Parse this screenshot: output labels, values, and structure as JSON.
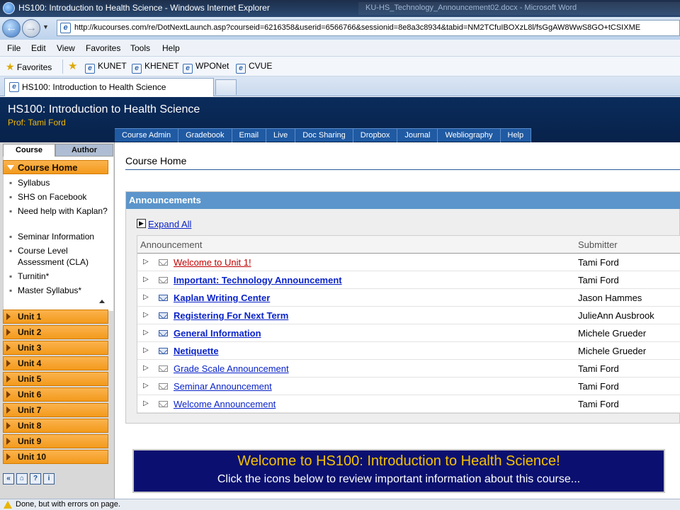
{
  "browser": {
    "window_title": "HS100: Introduction to Health Science - Windows Internet Explorer",
    "ghost_tab_title": "KU-HS_Technology_Announcement02.docx - Microsoft Word",
    "url": "http://kucourses.com/re/DotNextLaunch.asp?courseid=6216358&userid=6566766&sessionid=8e8a3c8934&tabid=NM2TCfuIBOXzL8l/fsGgAW8WwS8GO+tCSIXME",
    "menu": [
      "File",
      "Edit",
      "View",
      "Favorites",
      "Tools",
      "Help"
    ],
    "favorites_label": "Favorites",
    "favorites_links": [
      "KUNET",
      "KHENET",
      "WPONet",
      "CVUE"
    ],
    "active_tab_title": "HS100: Introduction to Health Science",
    "status_text": "Done, but with errors on page."
  },
  "course": {
    "title": "HS100: Introduction to Health Science",
    "prof_label": "Prof:  Tami Ford",
    "top_nav": [
      "Course Admin",
      "Gradebook",
      "Email",
      "Live",
      "Doc Sharing",
      "Dropbox",
      "Journal",
      "Webliography",
      "Help"
    ]
  },
  "sidebar": {
    "tabs": [
      "Course",
      "Author"
    ],
    "course_home": "Course Home",
    "links": [
      "Syllabus",
      "SHS on Facebook",
      "Need help with Kaplan?",
      "Seminar Information",
      "Course Level Assessment (CLA)",
      "Turnitin*",
      "Master Syllabus*"
    ],
    "units": [
      "Unit 1",
      "Unit 2",
      "Unit 3",
      "Unit 4",
      "Unit 5",
      "Unit 6",
      "Unit 7",
      "Unit 8",
      "Unit 9",
      "Unit 10"
    ],
    "tools": [
      "«",
      "⌂",
      "?",
      "i"
    ]
  },
  "main": {
    "page_title": "Course Home",
    "announcements_header": "Announcements",
    "expand_all": "Expand All",
    "columns": [
      "Announcement",
      "Submitter"
    ],
    "rows": [
      {
        "subject": "Welcome to Unit 1!",
        "submitter": "Tami Ford",
        "bold": false,
        "visited": true,
        "unread": false
      },
      {
        "subject": "Important: Technology Announcement",
        "submitter": "Tami Ford",
        "bold": true,
        "visited": false,
        "unread": false
      },
      {
        "subject": "Kaplan Writing Center",
        "submitter": "Jason Hammes",
        "bold": true,
        "visited": false,
        "unread": true
      },
      {
        "subject": "Registering For Next Term",
        "submitter": "JulieAnn Ausbrook",
        "bold": true,
        "visited": false,
        "unread": true
      },
      {
        "subject": "General Information",
        "submitter": "Michele Grueder",
        "bold": true,
        "visited": false,
        "unread": true
      },
      {
        "subject": "Netiquette",
        "submitter": "Michele Grueder",
        "bold": true,
        "visited": false,
        "unread": true
      },
      {
        "subject": "Grade Scale Announcement",
        "submitter": "Tami Ford",
        "bold": false,
        "visited": false,
        "unread": false
      },
      {
        "subject": "Seminar Announcement",
        "submitter": "Tami Ford",
        "bold": false,
        "visited": false,
        "unread": false
      },
      {
        "subject": "Welcome Announcement",
        "submitter": "Tami Ford",
        "bold": false,
        "visited": false,
        "unread": false
      }
    ],
    "welcome_title": "Welcome to HS100: Introduction to Health Science!",
    "welcome_sub": "Click the icons below to review important information about this course..."
  }
}
